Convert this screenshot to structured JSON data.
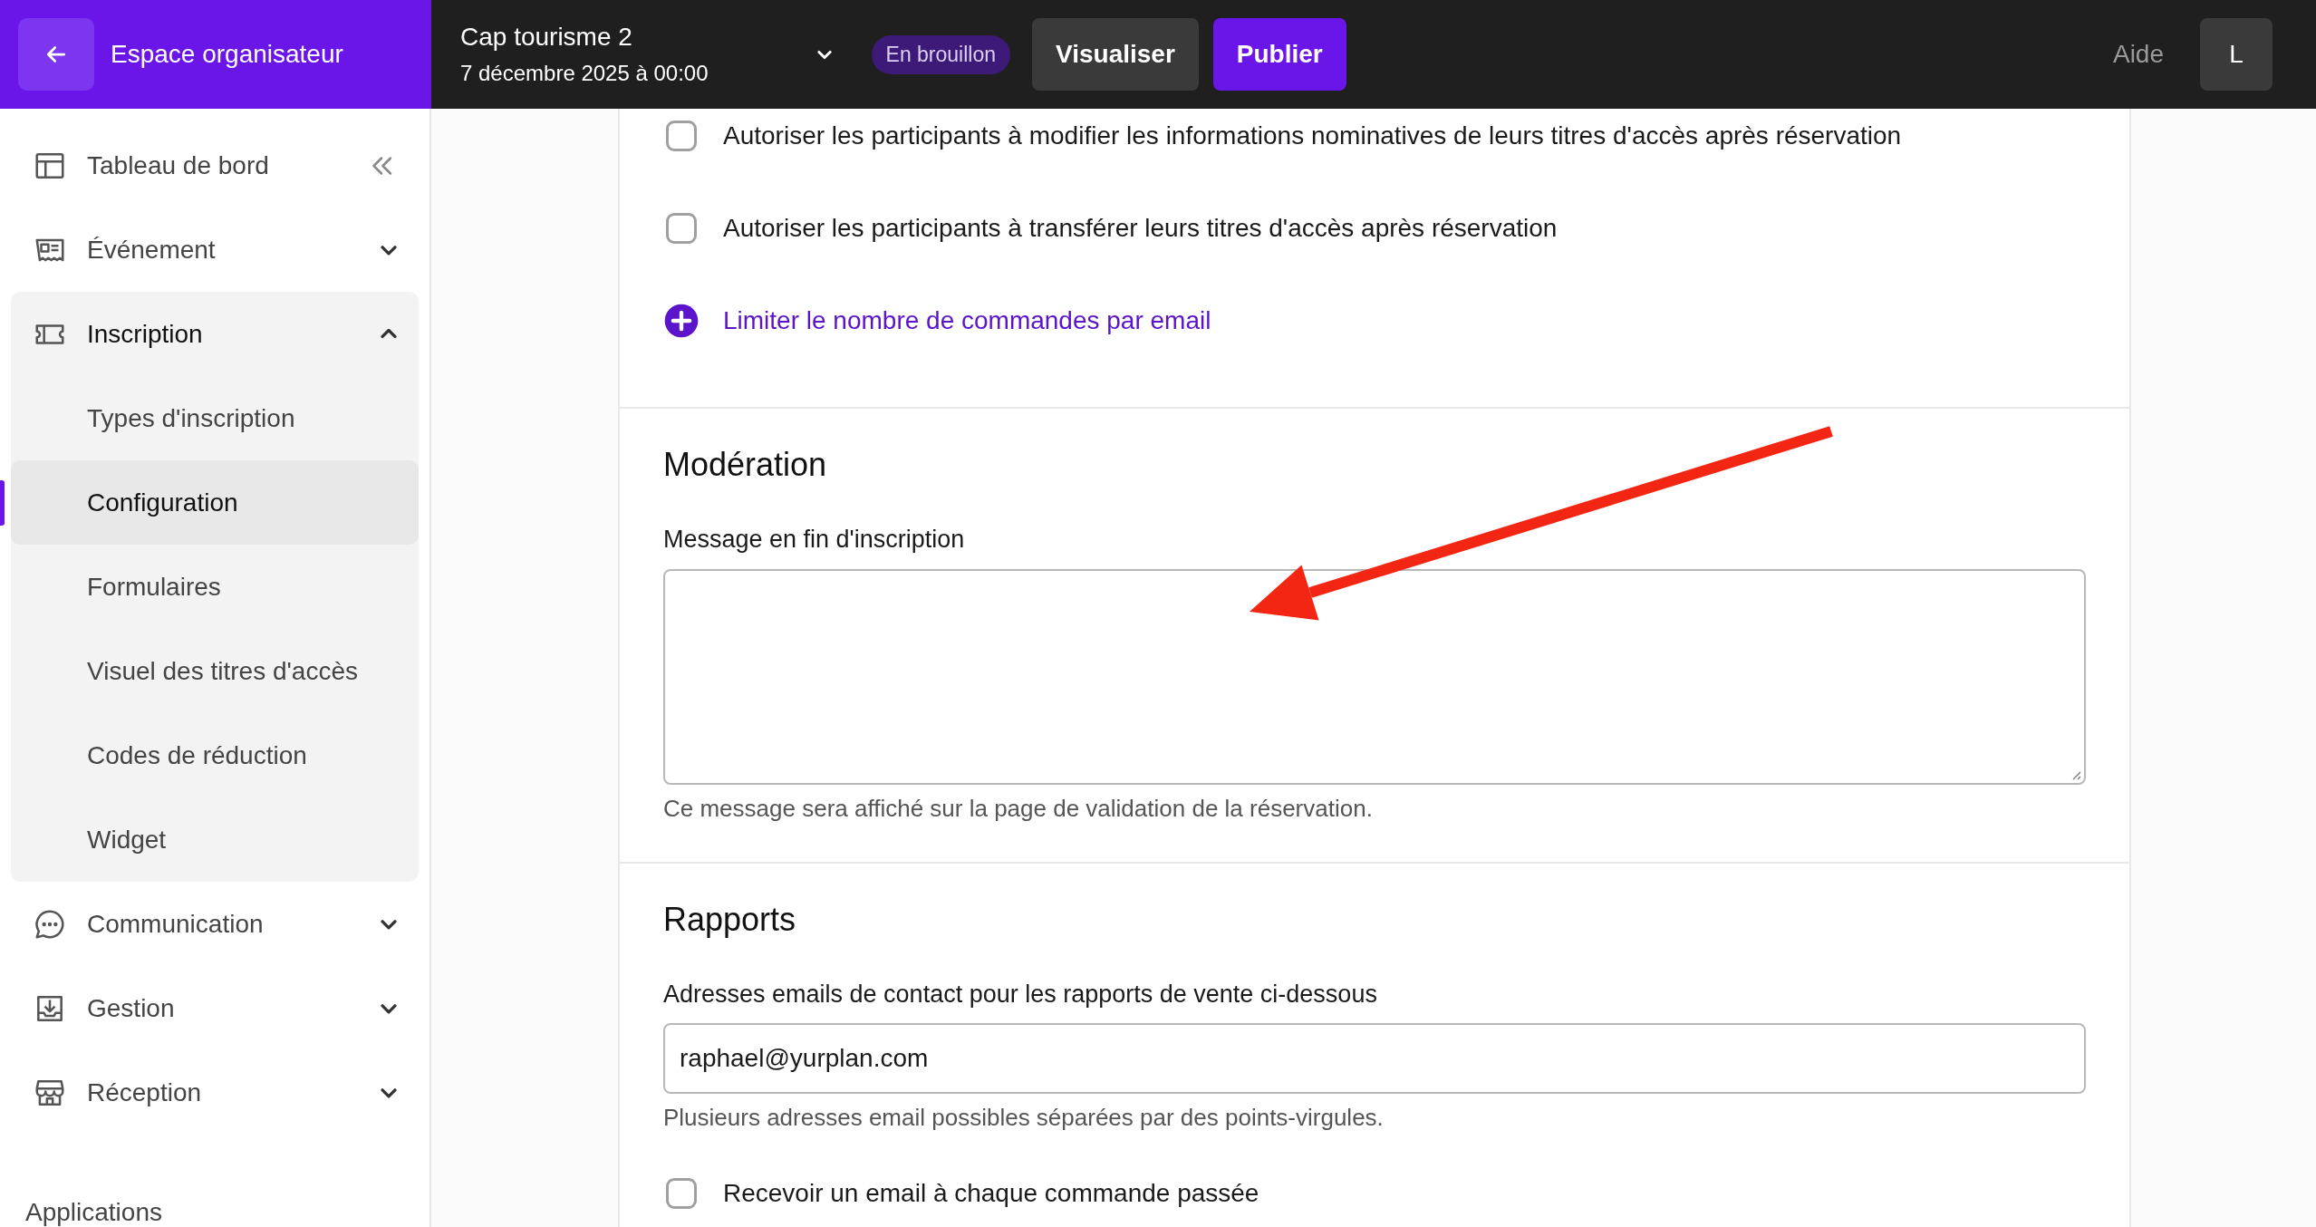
{
  "topbar": {
    "back_label": "Espace organisateur",
    "event_title": "Cap tourisme 2",
    "event_date": "7 décembre 2025 à 00:00",
    "status_badge": "En brouillon",
    "buttons": [
      {
        "label": "Visualiser",
        "kind": "secondary"
      },
      {
        "label": "Publier",
        "kind": "primary"
      }
    ],
    "help": "Aide",
    "avatar": "L"
  },
  "sidebar": {
    "items": [
      {
        "label": "Tableau de bord",
        "kind": "link"
      },
      {
        "label": "Événement",
        "kind": "group",
        "expanded": false
      },
      {
        "label": "Inscription",
        "kind": "group",
        "expanded": true,
        "children": [
          {
            "label": "Types d'inscription",
            "selected": false
          },
          {
            "label": "Configuration",
            "selected": true
          },
          {
            "label": "Formulaires",
            "selected": false
          },
          {
            "label": "Visuel des titres d'accès",
            "selected": false
          },
          {
            "label": "Codes de réduction",
            "selected": false
          },
          {
            "label": "Widget",
            "selected": false
          }
        ]
      },
      {
        "label": "Communication",
        "kind": "group",
        "expanded": false
      },
      {
        "label": "Gestion",
        "kind": "group",
        "expanded": false
      },
      {
        "label": "Réception",
        "kind": "group",
        "expanded": false
      }
    ],
    "footer_heading": "Applications"
  },
  "main": {
    "options": [
      {
        "kind": "checkbox",
        "label": "Autoriser les participants à modifier les informations nominatives de leurs titres d'accès après réservation",
        "checked": false
      },
      {
        "kind": "checkbox",
        "label": "Autoriser les participants à transférer leurs titres d'accès après réservation",
        "checked": false
      },
      {
        "kind": "add_link",
        "label": "Limiter le nombre de commandes par email"
      }
    ],
    "sections": [
      {
        "title": "Modération",
        "fields": [
          {
            "kind": "textarea",
            "label": "Message en fin d'inscription",
            "help": "Ce message sera affiché sur la page de validation de la réservation."
          }
        ]
      },
      {
        "title": "Rapports",
        "fields": [
          {
            "kind": "input",
            "label": "Adresses emails de contact pour les rapports de vente ci-dessous",
            "value": "raphael@yurplan.com",
            "help": "Plusieurs adresses email possibles séparées par des points-virgules."
          },
          {
            "kind": "checkbox",
            "label": "Recevoir un email à chaque commande passée",
            "checked": false
          }
        ]
      }
    ]
  }
}
